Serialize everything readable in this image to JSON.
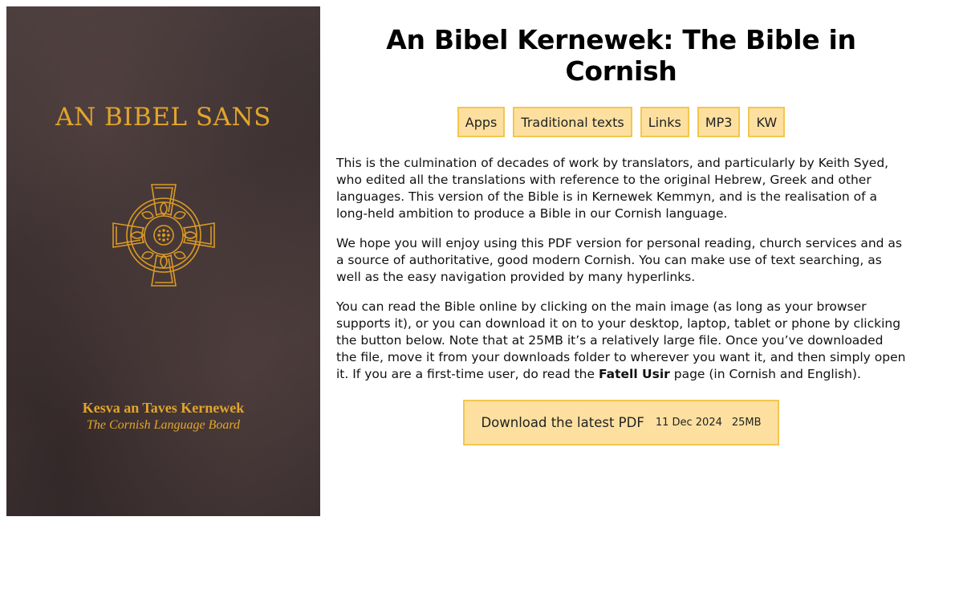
{
  "cover": {
    "title": "AN BIBEL SANS",
    "board_name": "Kesva an Taves Kernewek",
    "board_english": "The Cornish Language Board",
    "gold": "#e2a52a",
    "icon": "celtic-cross-icon"
  },
  "page": {
    "title": "An Bibel Kernewek: The Bible in Cornish"
  },
  "nav": {
    "apps": "Apps",
    "traditional": "Traditional texts",
    "links": "Links",
    "mp3": "MP3",
    "kw": "KW"
  },
  "content": {
    "p1": "This is the culmination of decades of work by translators, and particularly by Keith Syed, who edited all the translations with reference to the original Hebrew, Greek and other languages. This version of the Bible is in Kernewek Kemmyn, and is the realisation of a long-held ambition to produce a Bible in our Cornish language.",
    "p2": "We hope you will enjoy using this PDF version for personal reading, church services and as a source of authoritative, good modern Cornish. You can make use of text searching, as well as the easy navigation provided by many hyperlinks.",
    "p3_before": "You can read the Bible online by clicking on the main image (as long as your browser supports it), or you can download it on to your desktop, laptop, tablet or phone by clicking the button below. Note that at 25MB it’s a relatively large file. Once you’ve downloaded the file, move it from your downloads folder to wherever you want it, and then simply open it. If you are a first-time user, do read the ",
    "p3_link": "Fatell Usir",
    "p3_after": " page (in Cornish and English)."
  },
  "download": {
    "label": "Download the latest PDF",
    "date": "11 Dec 2024",
    "size": "25MB"
  },
  "colors": {
    "button_bg": "#fde0a0",
    "button_border": "#f3c64e"
  }
}
